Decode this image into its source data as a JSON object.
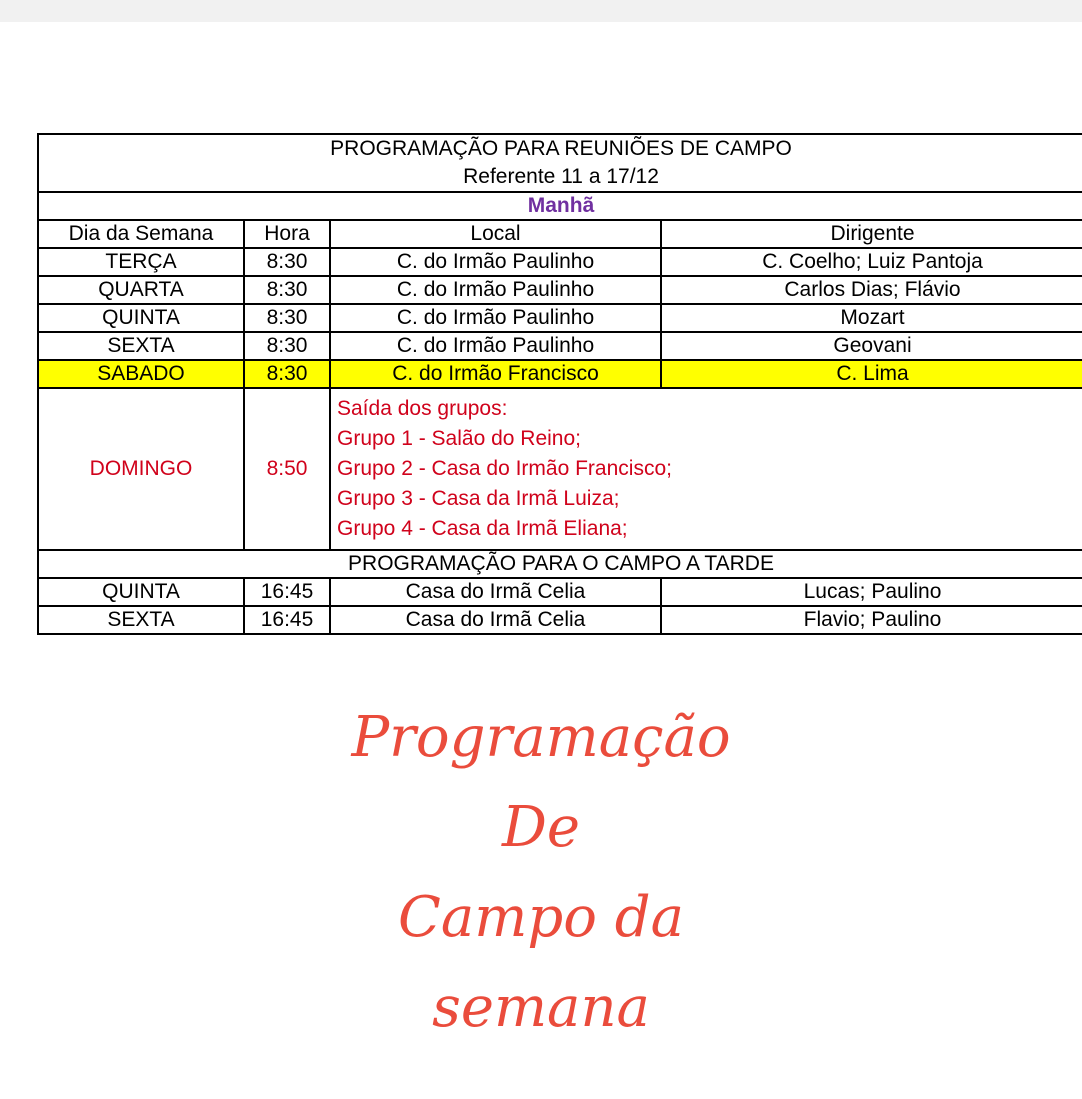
{
  "title": "PROGRAMAÇÃO PARA REUNIÕES DE CAMPO",
  "subtitle": "Referente 11 a 17/12",
  "section_morning": "Manhã",
  "headers": {
    "day": "Dia da Semana",
    "hour": "Hora",
    "local": "Local",
    "leader": "Dirigente"
  },
  "morning_rows": [
    {
      "day": "TERÇA",
      "hour": "8:30",
      "local": "C. do Irmão Paulinho",
      "leader": "C. Coelho; Luiz Pantoja"
    },
    {
      "day": "QUARTA",
      "hour": "8:30",
      "local": "C. do Irmão Paulinho",
      "leader": "Carlos Dias; Flávio"
    },
    {
      "day": "QUINTA",
      "hour": "8:30",
      "local": "C. do Irmão Paulinho",
      "leader": "Mozart"
    },
    {
      "day": "SEXTA",
      "hour": "8:30",
      "local": "C. do Irmão Paulinho",
      "leader": "Geovani"
    },
    {
      "day": "SABADO",
      "hour": "8:30",
      "local": "C. do Irmão Francisco",
      "leader": "C. Lima"
    }
  ],
  "sunday": {
    "day": "DOMINGO",
    "hour": "8:50",
    "lines": [
      "Saída dos grupos:",
      "Grupo 1 - Salão do Reino;",
      "Grupo 2 - Casa do Irmão Francisco;",
      "Grupo 3 - Casa da Irmã Luiza;",
      "Grupo 4 - Casa da Irmã Eliana;"
    ]
  },
  "section_afternoon": "PROGRAMAÇÃO PARA O CAMPO A TARDE",
  "afternoon_rows": [
    {
      "day": "QUINTA",
      "hour": "16:45",
      "local": "Casa do Irmã Celia",
      "leader": "Lucas; Paulino"
    },
    {
      "day": "SEXTA",
      "hour": "16:45",
      "local": "Casa do Irmã Celia",
      "leader": "Flavio; Paulino"
    }
  ],
  "caption": [
    "Programação",
    "De",
    "Campo da",
    "semana"
  ],
  "colors": {
    "highlight": "#ffff00",
    "sunday_text": "#d0021b",
    "morning_label": "#7030a0",
    "caption": "#ea4c3c"
  }
}
